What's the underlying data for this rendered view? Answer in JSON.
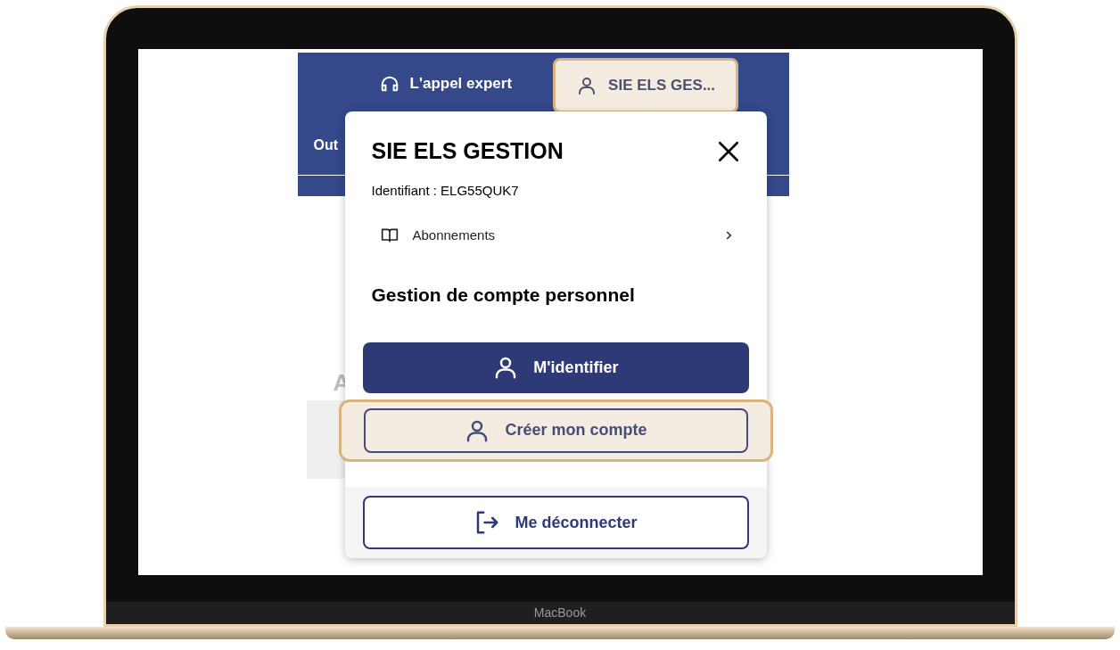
{
  "header": {
    "expert_link": "L'appel expert",
    "account_button": {
      "label": "SIE ELS GES...",
      "highlighted": true
    },
    "nav_item": "Out"
  },
  "background": {
    "heading_fragment": "A"
  },
  "account_menu": {
    "title": "SIE ELS GESTION",
    "identifier": "Identifiant : ELG55QUK7",
    "menu_items": [
      {
        "label": "Abonnements"
      }
    ],
    "section_title": "Gestion de compte personnel",
    "buttons": [
      {
        "kind": "primary",
        "label": "M'identifier",
        "highlighted": false
      },
      {
        "kind": "outline",
        "label": "Créer mon compte",
        "highlighted": true
      }
    ],
    "logout_button": "Me déconnecter"
  },
  "device": {
    "label": "MacBook"
  }
}
